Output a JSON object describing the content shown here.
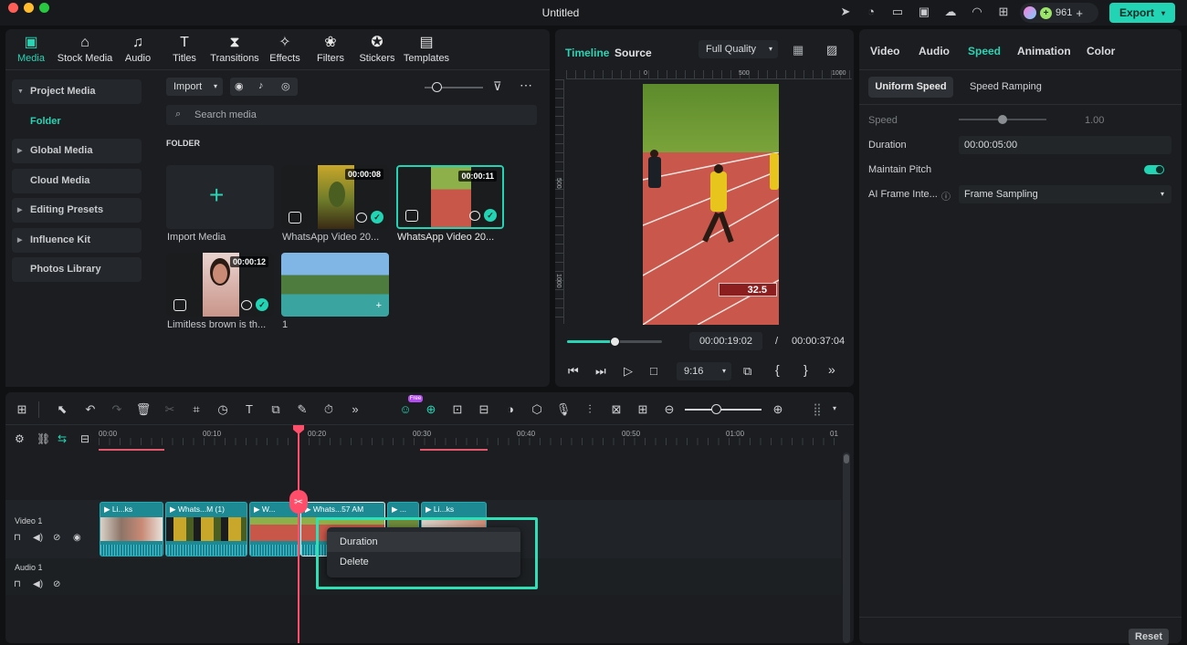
{
  "window": {
    "title": "Untitled",
    "credits": "961",
    "export_label": "Export"
  },
  "colors": {
    "accent": "#22d3b4",
    "clip": "#1d8a93",
    "playhead": "#ff4d6a"
  },
  "media_tabs": [
    {
      "label": "Media",
      "icon": "media-icon"
    },
    {
      "label": "Stock Media",
      "icon": "stock-media-icon"
    },
    {
      "label": "Audio",
      "icon": "audio-icon"
    },
    {
      "label": "Titles",
      "icon": "titles-icon"
    },
    {
      "label": "Transitions",
      "icon": "transitions-icon"
    },
    {
      "label": "Effects",
      "icon": "effects-icon"
    },
    {
      "label": "Filters",
      "icon": "filters-icon"
    },
    {
      "label": "Stickers",
      "icon": "stickers-icon"
    },
    {
      "label": "Templates",
      "icon": "templates-icon"
    }
  ],
  "sidebar": {
    "project_media": "Project Media",
    "folder": "Folder",
    "global_media": "Global Media",
    "cloud_media": "Cloud Media",
    "editing_presets": "Editing Presets",
    "influence_kit": "Influence Kit",
    "photos_library": "Photos Library"
  },
  "media": {
    "import_label": "Import",
    "search_placeholder": "Search media",
    "folder_heading": "FOLDER",
    "items": [
      {
        "label": "Import Media",
        "duration": ""
      },
      {
        "label": "WhatsApp Video 20...",
        "duration": "00:00:08"
      },
      {
        "label": "WhatsApp Video 20...",
        "duration": "00:00:11"
      },
      {
        "label": "Limitless brown is th...",
        "duration": "00:00:12"
      },
      {
        "label": "1",
        "duration": ""
      }
    ]
  },
  "preview": {
    "tab_timeline": "Timeline",
    "tab_source": "Source",
    "quality": "Full Quality",
    "ruler": [
      "0",
      "500",
      "1000"
    ],
    "vruler": [
      "500",
      "1000"
    ],
    "scoreboard": "32.5",
    "current_time": "00:00:19:02",
    "separator": "/",
    "total_time": "00:00:37:04",
    "aspect": "9:16",
    "progress": 0.5
  },
  "properties": {
    "tabs": [
      "Video",
      "Audio",
      "Speed",
      "Animation",
      "Color"
    ],
    "subtab_uniform": "Uniform Speed",
    "subtab_ramping": "Speed Ramping",
    "speed_label": "Speed",
    "speed_value": "1.00",
    "duration_label": "Duration",
    "duration_value": "00:00:05:00",
    "pitch_label": "Maintain Pitch",
    "ai_label": "AI Frame Inte...",
    "ai_value": "Frame Sampling",
    "reset_label": "Reset"
  },
  "timeline": {
    "badge": "Free",
    "ruler": [
      "00:00",
      "00:10",
      "00:20",
      "00:30",
      "00:40",
      "00:50",
      "01:00",
      "01"
    ],
    "video_track": "Video 1",
    "audio_track": "Audio 1",
    "clips": [
      {
        "label": "Li...ks"
      },
      {
        "label": "Whats...M (1)"
      },
      {
        "label": "W..."
      },
      {
        "label": "Whats...57 AM"
      },
      {
        "label": "..."
      },
      {
        "label": "Li...ks"
      }
    ]
  },
  "context_menu": {
    "items": [
      "Duration",
      "Delete"
    ]
  }
}
